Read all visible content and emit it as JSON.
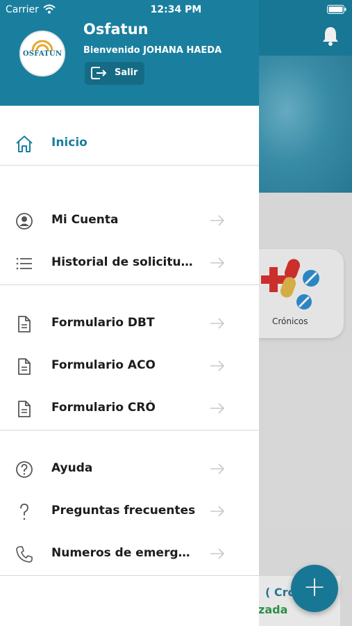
{
  "status_bar": {
    "carrier": "Carrier",
    "time": "12:34 PM"
  },
  "drawer": {
    "app_title": "Osfatun",
    "welcome": "Bienvenido JOHANA HAEDA",
    "logo_text": "OSFATUN",
    "logout_label": "Salir",
    "home": {
      "label": "Inicio",
      "icon": "home-icon"
    },
    "sections": [
      [
        {
          "label": "Mi Cuenta",
          "icon": "user-circle-icon"
        },
        {
          "label": "Historial de solicitudes",
          "icon": "list-icon"
        }
      ],
      [
        {
          "label": "Formulario DBT",
          "icon": "document-icon"
        },
        {
          "label": "Formulario ACO",
          "icon": "document-icon"
        },
        {
          "label": "Formulario CRÓ",
          "icon": "document-icon"
        }
      ],
      [
        {
          "label": "Ayuda",
          "icon": "help-circle-icon"
        },
        {
          "label": "Preguntas frecuentes",
          "icon": "question-icon"
        },
        {
          "label": "Numeros de emergencia",
          "icon": "phone-icon"
        }
      ]
    ]
  },
  "background": {
    "card_label": "Crónicos",
    "bottom_line1": "( Cró",
    "bottom_line2": "zada",
    "fab_label": "+"
  },
  "colors": {
    "primary": "#1a7f9e",
    "primary_dark": "#156b85",
    "green": "#2f9a4b"
  }
}
